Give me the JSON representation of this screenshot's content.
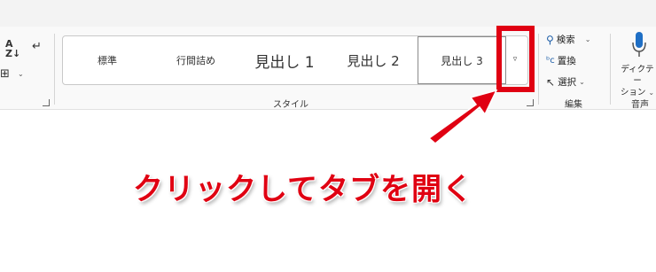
{
  "ribbon": {
    "styles_group": {
      "label": "スタイル",
      "items": [
        "標準",
        "行間詰め",
        "見出し 1",
        "見出し 2",
        "見出し 3"
      ],
      "selected": "見出し 3",
      "more_button": "▿"
    },
    "editing_group": {
      "label": "編集",
      "find": "検索",
      "replace": "置換",
      "select": "選択"
    },
    "voice_group": {
      "label": "音声",
      "dictate_line1": "ディクテー",
      "dictate_line2": "ション"
    },
    "left_group": {
      "sort_icon": "sort-az-icon",
      "paragraph_mark_icon": "paragraph-mark-icon",
      "borders_icon": "borders-icon"
    }
  },
  "annotation": {
    "text": "クリックしてタブを開く",
    "color": "#e00012"
  }
}
